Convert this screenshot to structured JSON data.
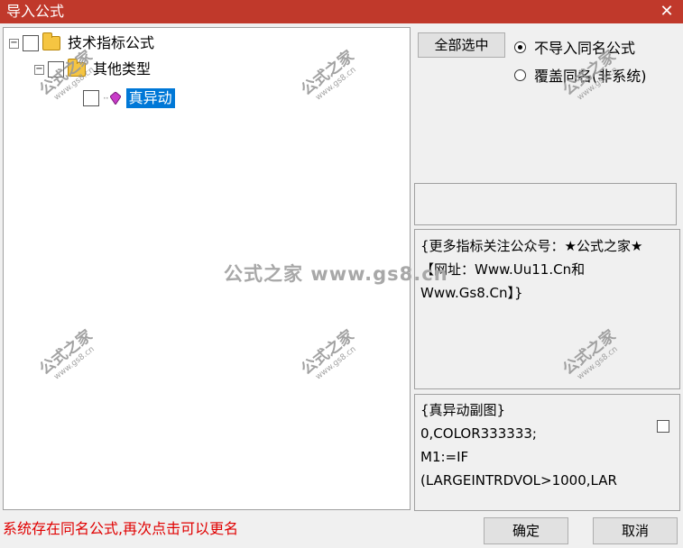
{
  "window": {
    "title": "导入公式",
    "close_glyph": "✕"
  },
  "tree": {
    "root": {
      "label": "技术指标公式",
      "expander": "⊟",
      "icon": "folder-icon"
    },
    "child": {
      "label": "其他类型",
      "expander": "⊟",
      "icon": "folder-icon"
    },
    "leaf": {
      "label": "真异动",
      "icon": "gem-icon",
      "selected": true
    }
  },
  "controls": {
    "select_all_label": "全部选中",
    "radio_options": [
      {
        "label": "不导入同名公式",
        "checked": true
      },
      {
        "label": "覆盖同名(非系统)",
        "checked": false
      }
    ]
  },
  "description": {
    "text": "{更多指标关注公众号：★公式之家★ 【网址：Www.Uu11.Cn和Www.Gs8.Cn】}"
  },
  "code": {
    "lines": [
      "{真异动副图}",
      "0,COLOR333333;",
      "M1:=IF",
      "(LARGEINTRDVOL>1000,LAR"
    ]
  },
  "footer": {
    "status": "系统存在同名公式,再次点击可以更名",
    "ok_label": "确定",
    "cancel_label": "取消"
  },
  "watermark": {
    "center_text": "公式之家 www.gs8.cn",
    "stamp_main": "公式之家",
    "stamp_sub": "www.gs8.cn"
  },
  "colors": {
    "titlebar": "#c0392b",
    "selection": "#0078d7",
    "status_text": "#e00000"
  }
}
